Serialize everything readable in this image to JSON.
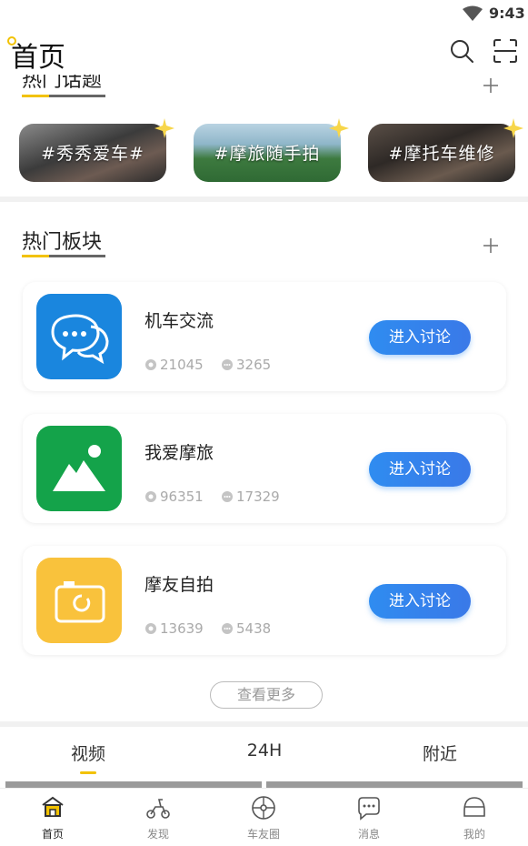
{
  "status_bar": {
    "time": "9:43"
  },
  "header": {
    "title": "首页"
  },
  "hot_topics": {
    "title": "热门话题",
    "items": [
      {
        "label": "#秀秀爱车#"
      },
      {
        "label": "#摩旅随手拍"
      },
      {
        "label": "#摩托车维修"
      }
    ]
  },
  "hot_boards": {
    "title": "热门板块",
    "items": [
      {
        "name": "机车交流",
        "views": "21045",
        "comments": "3265",
        "button": "进入讨论",
        "color": "#1a86de"
      },
      {
        "name": "我爱摩旅",
        "views": "96351",
        "comments": "17329",
        "button": "进入讨论",
        "color": "#14a34a"
      },
      {
        "name": "摩友自拍",
        "views": "13639",
        "comments": "5438",
        "button": "进入讨论",
        "color": "#f9c23c"
      }
    ],
    "more_label": "查看更多"
  },
  "sub_tabs": [
    {
      "label": "视频"
    },
    {
      "label": "24H"
    },
    {
      "label": "附近"
    }
  ],
  "bottom_nav": [
    {
      "label": "首页",
      "icon": "home-icon"
    },
    {
      "label": "发现",
      "icon": "scooter-icon"
    },
    {
      "label": "车友圈",
      "icon": "wheel-icon"
    },
    {
      "label": "消息",
      "icon": "chat-icon"
    },
    {
      "label": "我的",
      "icon": "helmet-icon"
    }
  ],
  "colors": {
    "accent": "#f2c200",
    "button_blue": "#2f8cf0"
  }
}
